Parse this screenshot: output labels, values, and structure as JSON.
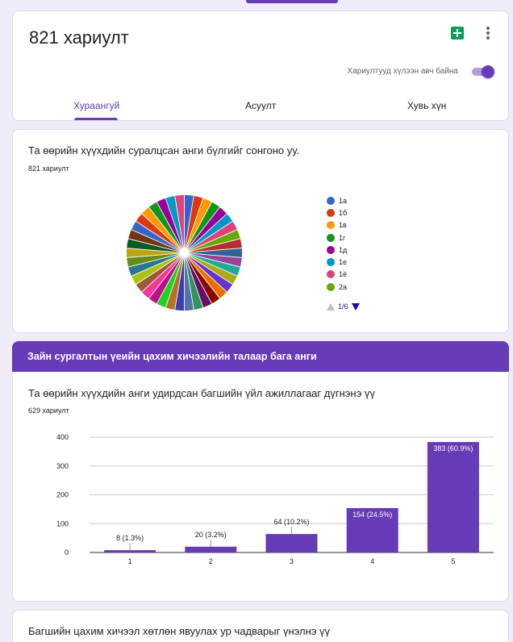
{
  "header": {
    "title": "821 хариулт",
    "accepting_label": "Хариултууд хүлээн авч байна",
    "accepting": true,
    "tabs": [
      {
        "label": "Хураангуй",
        "active": true
      },
      {
        "label": "Асуулт",
        "active": false
      },
      {
        "label": "Хувь хүн",
        "active": false
      }
    ]
  },
  "colors": {
    "accent": "#673ab7"
  },
  "q1": {
    "title": "Та өөрийн хүүхдийн суралцсан анги бүлгийг сонгоно уу.",
    "count": "821 хариулт",
    "legend": [
      {
        "label": "1а",
        "color": "#3366cc"
      },
      {
        "label": "1б",
        "color": "#dc3912"
      },
      {
        "label": "1в",
        "color": "#ff9900"
      },
      {
        "label": "1г",
        "color": "#109618"
      },
      {
        "label": "1д",
        "color": "#990099"
      },
      {
        "label": "1е",
        "color": "#0099c6"
      },
      {
        "label": "1ё",
        "color": "#dd4477"
      },
      {
        "label": "2а",
        "color": "#66aa00"
      }
    ],
    "pager": "1/6"
  },
  "section": {
    "title": "Зайн сургалтын үеийн цахим хичээлийн талаар бага анги"
  },
  "q2": {
    "title": "Та өөрийн хүүхдийн анги удирдсан багшийн үйл ажиллагааг дүгнэнэ үү",
    "count": "629 хариулт"
  },
  "q3": {
    "title": "Багшийн цахим хичээл хөтлөн явуулах ур чадварыг үнэлнэ үү"
  },
  "chart_data": [
    {
      "type": "pie",
      "title": "",
      "slice_colors": [
        "#3366cc",
        "#dc3912",
        "#ff9900",
        "#109618",
        "#990099",
        "#0099c6",
        "#dd4477",
        "#66aa00",
        "#b82e2e",
        "#316395",
        "#994499",
        "#22aa99",
        "#aaaa11",
        "#6633cc",
        "#e67300",
        "#8b0707",
        "#651067",
        "#329262",
        "#5574a6",
        "#3b3eac",
        "#b77322",
        "#16d620",
        "#b91383",
        "#f4359e",
        "#9c5935",
        "#a9c413",
        "#2a778d",
        "#668d1c",
        "#bea413",
        "#0c5922",
        "#743411"
      ],
      "legend_visible": [
        "1а",
        "1б",
        "1в",
        "1г",
        "1д",
        "1е",
        "1ё",
        "2а"
      ],
      "slice_count": 38
    },
    {
      "type": "bar",
      "categories": [
        "1",
        "2",
        "3",
        "4",
        "5"
      ],
      "values": [
        8,
        20,
        64,
        154,
        383
      ],
      "labels": [
        "8 (1.3%)",
        "20 (3.2%)",
        "64 (10.2%)",
        "154 (24.5%)",
        "383 (60.9%)"
      ],
      "yticks": [
        0,
        100,
        200,
        300,
        400
      ],
      "ylim": [
        0,
        400
      ],
      "color": "#673ab7",
      "xlabel": "",
      "ylabel": "",
      "title": ""
    }
  ]
}
